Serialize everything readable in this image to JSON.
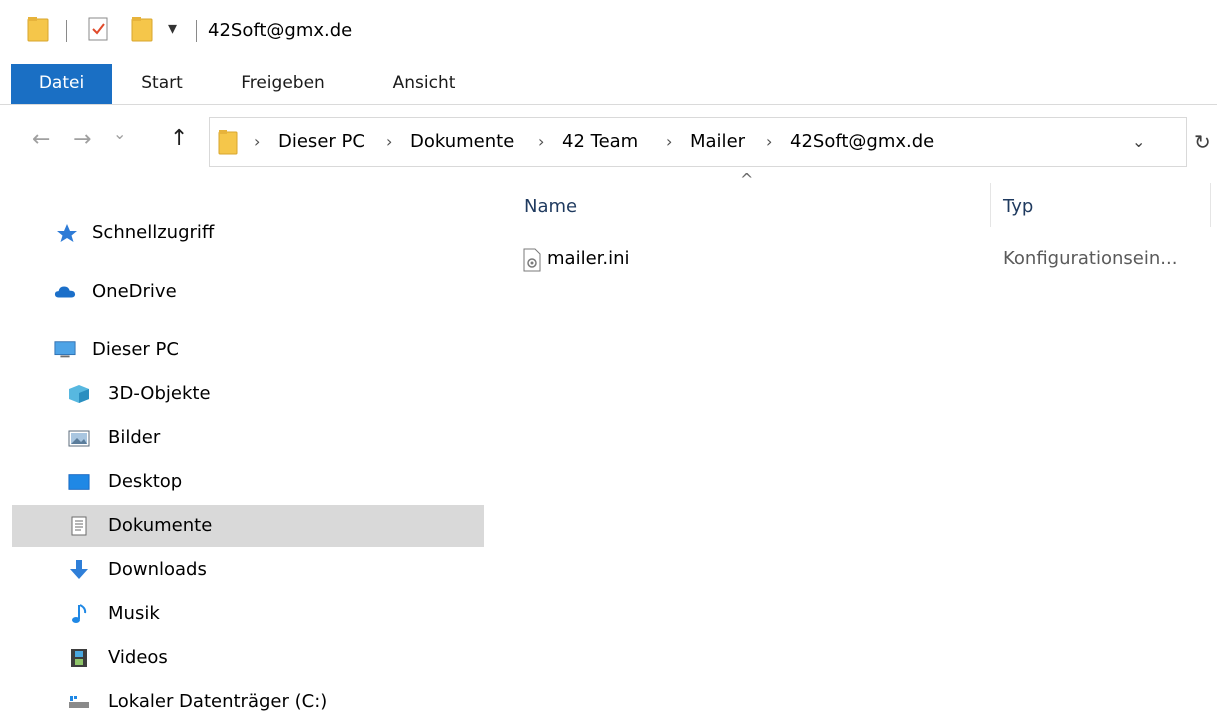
{
  "window": {
    "title": "42Soft@gmx.de",
    "quick_access_dropdown": "▾"
  },
  "ribbon": {
    "tabs": [
      {
        "label": "Datei"
      },
      {
        "label": "Start"
      },
      {
        "label": "Freigeben"
      },
      {
        "label": "Ansicht"
      }
    ]
  },
  "navigation": {
    "back": "←",
    "forward": "→",
    "recent": "⌄",
    "up": "↑",
    "dropdown": "⌄",
    "refresh": "↻"
  },
  "address": {
    "crumbs": [
      "Dieser PC",
      "Dokumente",
      "42 Team",
      "Mailer",
      "42Soft@gmx.de"
    ],
    "separator": "›"
  },
  "sidebar": {
    "items": [
      {
        "label": "Schnellzugriff",
        "icon": "star-icon"
      },
      {
        "label": "OneDrive",
        "icon": "cloud-icon"
      },
      {
        "label": "Dieser PC",
        "icon": "computer-icon"
      },
      {
        "label": "3D-Objekte",
        "icon": "cube-icon"
      },
      {
        "label": "Bilder",
        "icon": "pictures-icon"
      },
      {
        "label": "Desktop",
        "icon": "desktop-icon"
      },
      {
        "label": "Dokumente",
        "icon": "document-icon",
        "selected": true
      },
      {
        "label": "Downloads",
        "icon": "download-arrow-icon"
      },
      {
        "label": "Musik",
        "icon": "music-note-icon"
      },
      {
        "label": "Videos",
        "icon": "film-icon"
      },
      {
        "label": "Lokaler Datenträger (C:)",
        "icon": "drive-icon"
      }
    ]
  },
  "filelist": {
    "sort_indicator": "^",
    "columns": [
      {
        "label": "Name"
      },
      {
        "label": "Typ"
      }
    ],
    "rows": [
      {
        "name": "mailer.ini",
        "type": "Konfigurationsein..."
      }
    ]
  },
  "colors": {
    "accent": "#1a6fc4",
    "selected_bg": "#d9d9d9",
    "folder_yellow": "#f5c64a"
  }
}
